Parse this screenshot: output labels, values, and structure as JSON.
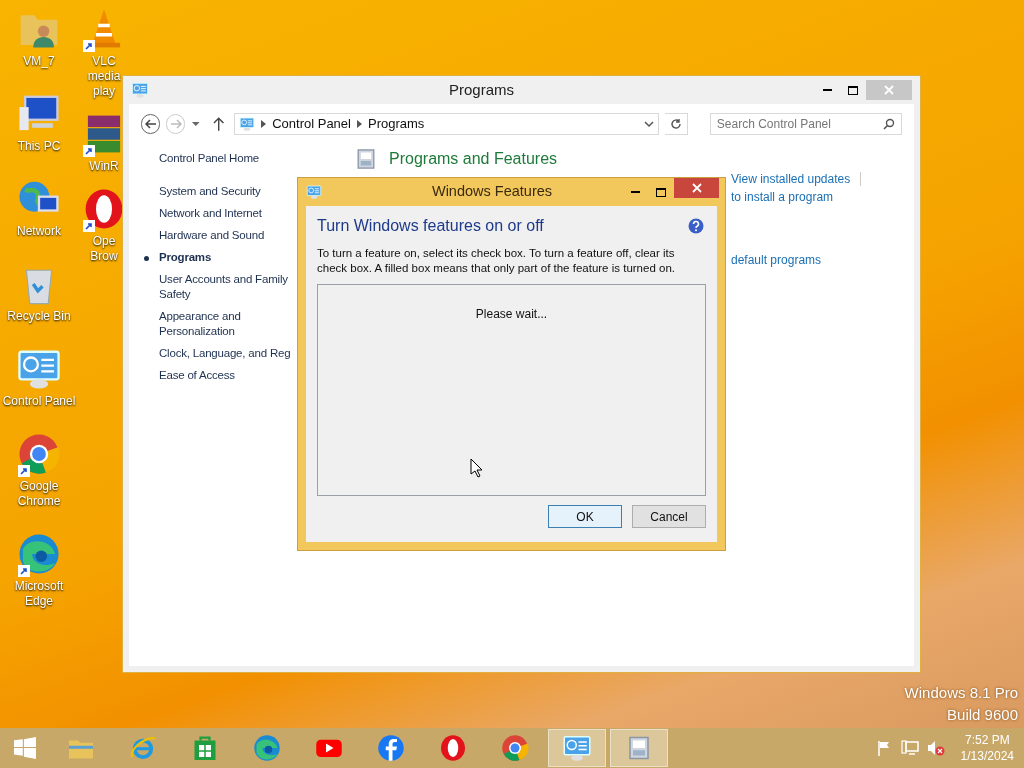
{
  "desktop": {
    "icon_columns": [
      [
        {
          "label": "VM_7",
          "kind": "user-folder",
          "shortcut": false
        },
        {
          "label": "This PC",
          "kind": "pc",
          "shortcut": false
        },
        {
          "label": "Network",
          "kind": "network",
          "shortcut": false
        },
        {
          "label": "Recycle Bin",
          "kind": "recycle-bin",
          "shortcut": false
        },
        {
          "label": "Control Panel",
          "kind": "control-panel",
          "shortcut": false
        },
        {
          "label": "Google Chrome",
          "kind": "chrome",
          "shortcut": true
        },
        {
          "label": "Microsoft Edge",
          "kind": "edge",
          "shortcut": true
        }
      ],
      [
        {
          "label": "VLC media play",
          "kind": "vlc",
          "shortcut": true
        },
        {
          "label": "WinR",
          "kind": "winrar",
          "shortcut": true
        },
        {
          "label": "Ope Brow",
          "kind": "opera",
          "shortcut": true
        }
      ]
    ],
    "version_lines": [
      "Windows 8.1 Pro",
      "Build 9600"
    ]
  },
  "control_panel": {
    "title": "Programs",
    "breadcrumb": [
      "Control Panel",
      "Programs"
    ],
    "search": {
      "placeholder": "Search Control Panel"
    },
    "home_link": "Control Panel Home",
    "sidebar": [
      {
        "label": "System and Security",
        "selected": false
      },
      {
        "label": "Network and Internet",
        "selected": false
      },
      {
        "label": "Hardware and Sound",
        "selected": false
      },
      {
        "label": "Programs",
        "selected": true
      },
      {
        "label": "User Accounts and Family Safety",
        "selected": false
      },
      {
        "label": "Appearance and Personalization",
        "selected": false
      },
      {
        "label": "Clock, Language, and Reg",
        "selected": false
      },
      {
        "label": "Ease of Access",
        "selected": false
      }
    ],
    "heading": "Programs and Features",
    "links": [
      "View installed updates",
      "to install a program",
      "default programs"
    ]
  },
  "dialog": {
    "title": "Windows Features",
    "heading": "Turn Windows features on or off",
    "description": "To turn a feature on, select its check box. To turn a feature off, clear its check box. A filled box means that only part of the feature is turned on.",
    "status": "Please wait...",
    "buttons": [
      {
        "label": "OK",
        "default": true
      },
      {
        "label": "Cancel",
        "default": false
      }
    ]
  },
  "taskbar": {
    "items": [
      {
        "kind": "file-explorer",
        "active": false
      },
      {
        "kind": "internet-explorer",
        "active": false
      },
      {
        "kind": "store",
        "active": false
      },
      {
        "kind": "edge",
        "active": false
      },
      {
        "kind": "youtube",
        "active": false
      },
      {
        "kind": "facebook",
        "active": false
      },
      {
        "kind": "opera",
        "active": false
      },
      {
        "kind": "chrome",
        "active": false
      },
      {
        "kind": "control-panel",
        "active": true
      },
      {
        "kind": "windows-features",
        "active": true
      }
    ],
    "time": "7:52 PM",
    "date": "1/13/2024"
  }
}
